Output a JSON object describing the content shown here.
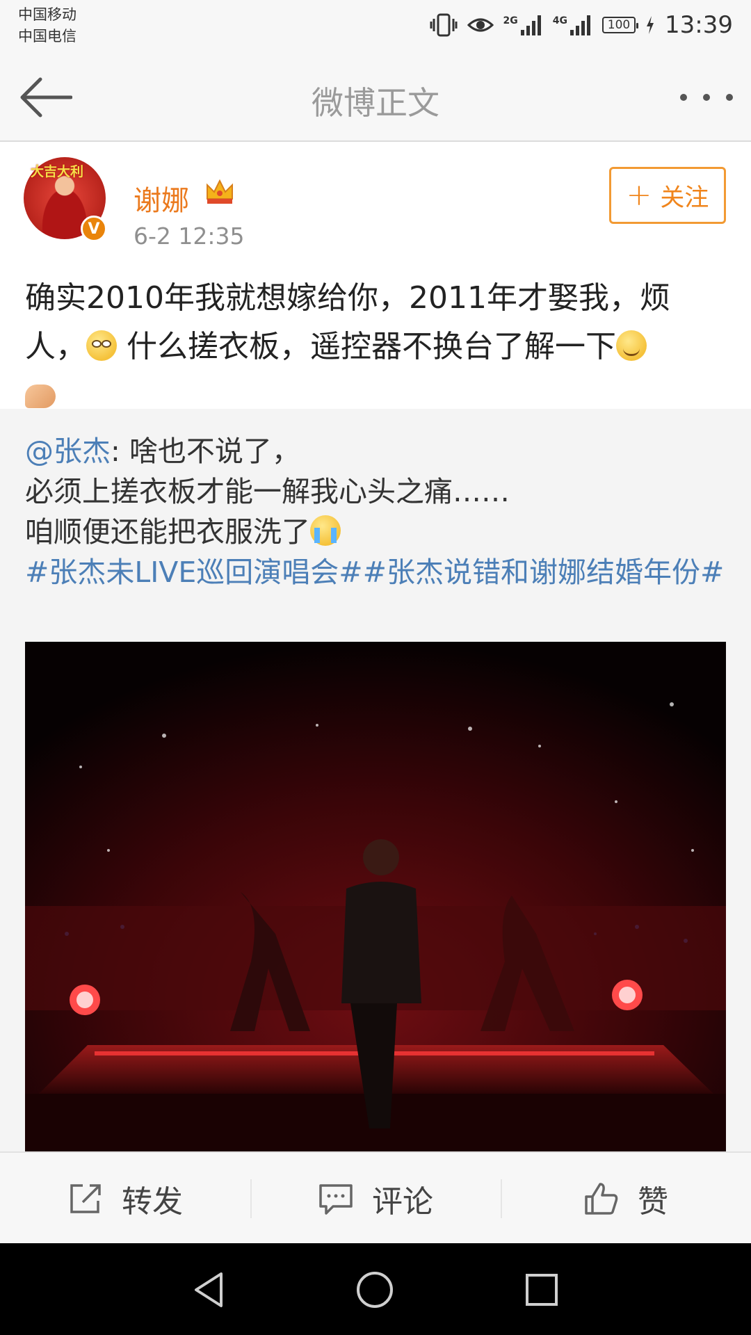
{
  "status_bar": {
    "carrier1": "中国移动",
    "carrier2": "中国电信",
    "net1": "2G",
    "net2": "4G",
    "battery": "100",
    "time": "13:39",
    "icons": [
      "vibrate-icon",
      "eye-icon",
      "signal-icon",
      "charging-icon"
    ]
  },
  "nav": {
    "title": "微博正文",
    "back_icon": "arrow-left-icon",
    "more_icon": "more-dots-icon"
  },
  "post": {
    "username": "谢娜",
    "time": "6-2 12:35",
    "follow_label": "关注",
    "text_part1": "确实2010年我就想嫁给你，2011年才娶我，烦人，",
    "text_part2": " 什么搓衣板，遥控器不换台了解一下",
    "avatar_caption": "大吉大利"
  },
  "repost": {
    "mention": "@张杰",
    "line1": ": 啥也不说了，",
    "line2": "必须上搓衣板才能一解我心头之痛……",
    "line3": "咱顺便还能把衣服洗了",
    "hashtags": "#张杰未LIVE巡回演唱会##张杰说错和谢娜结婚年份#"
  },
  "actions": {
    "repost": "转发",
    "comment": "评论",
    "like": "赞"
  },
  "colors": {
    "accent_orange": "#f0851c",
    "link_blue": "#4c7fb7",
    "title_gray": "#9a9a9a"
  }
}
